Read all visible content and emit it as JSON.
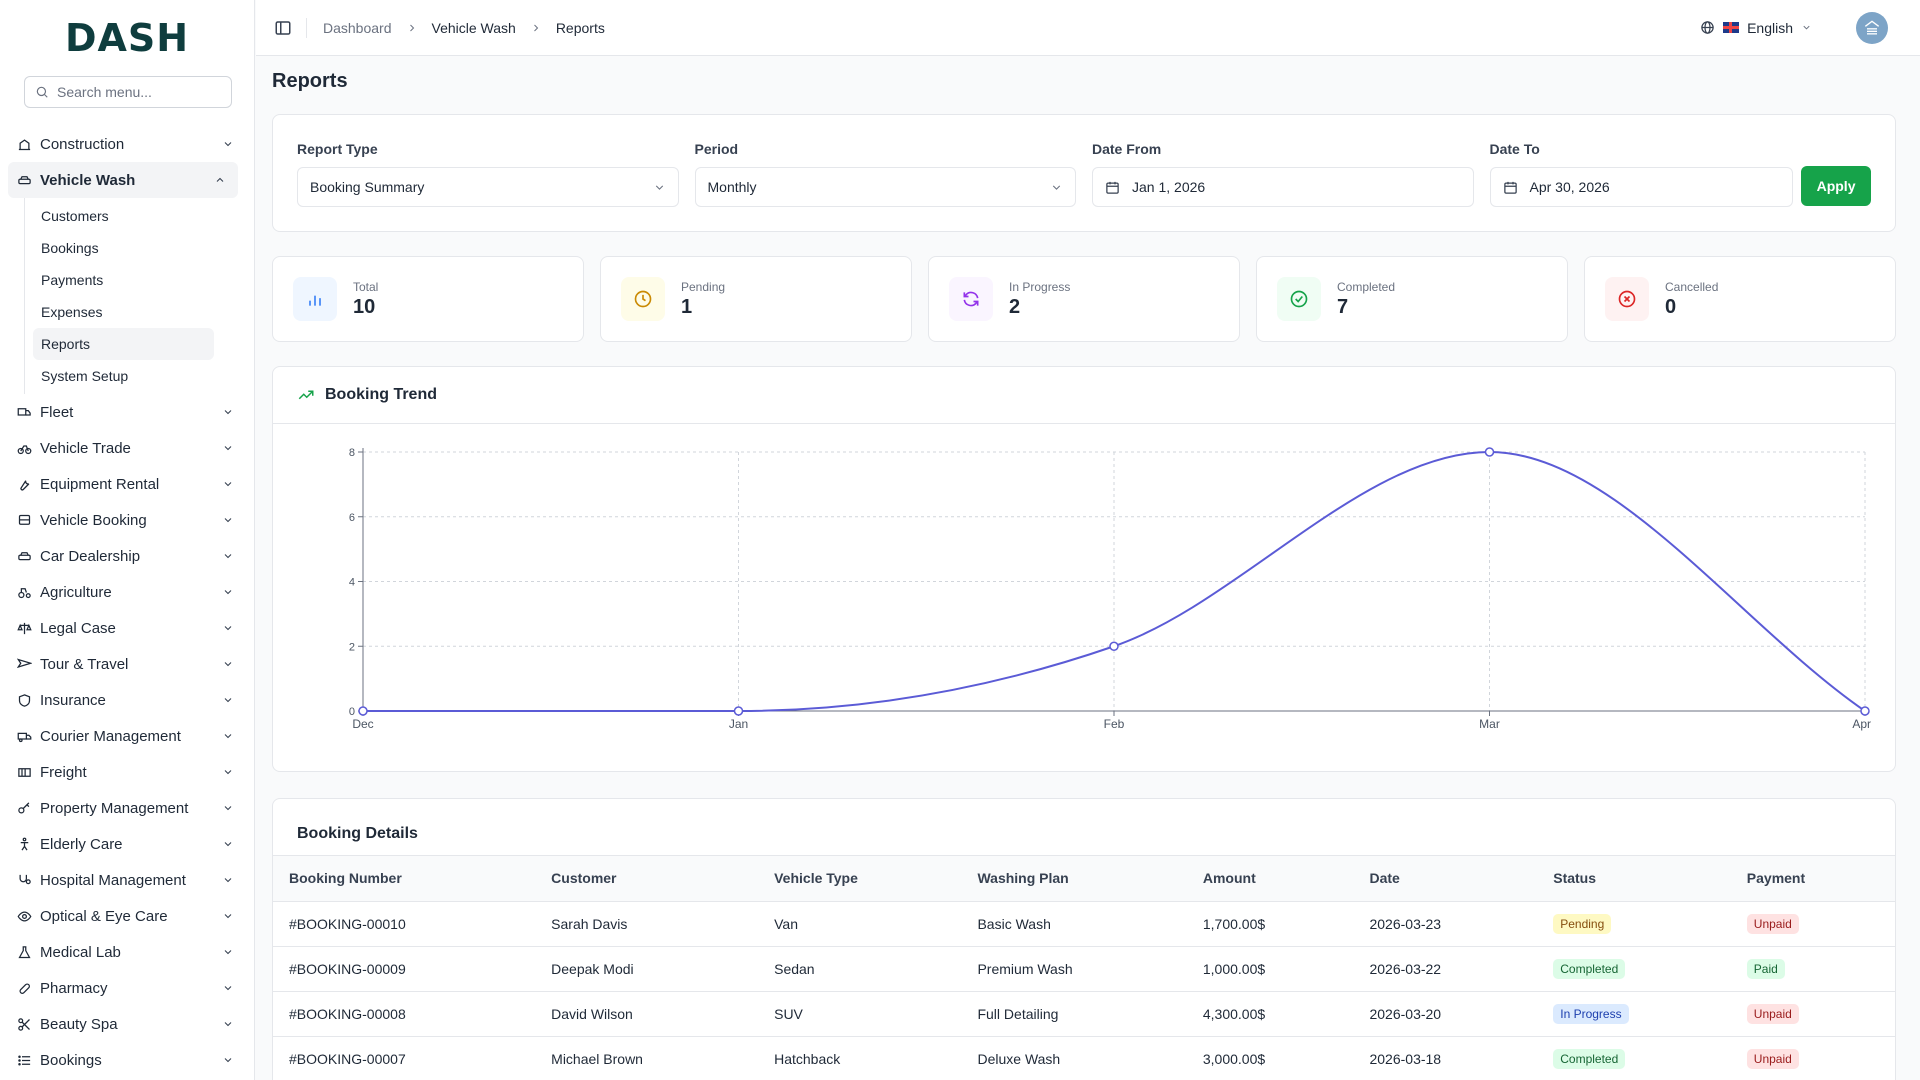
{
  "app": {
    "logo": "DASH"
  },
  "sidebar": {
    "search_placeholder": "Search menu...",
    "items": [
      {
        "label": "Construction",
        "icon": "construction-icon"
      },
      {
        "label": "Vehicle Wash",
        "icon": "car-icon",
        "active": true,
        "children": [
          {
            "label": "Customers"
          },
          {
            "label": "Bookings"
          },
          {
            "label": "Payments"
          },
          {
            "label": "Expenses"
          },
          {
            "label": "Reports",
            "active": true
          },
          {
            "label": "System Setup"
          }
        ]
      },
      {
        "label": "Fleet",
        "icon": "truck-icon"
      },
      {
        "label": "Vehicle Trade",
        "icon": "bike-icon"
      },
      {
        "label": "Equipment Rental",
        "icon": "wrench-icon"
      },
      {
        "label": "Vehicle Booking",
        "icon": "bus-icon"
      },
      {
        "label": "Car Dealership",
        "icon": "car-icon"
      },
      {
        "label": "Agriculture",
        "icon": "tractor-icon"
      },
      {
        "label": "Legal Case",
        "icon": "scale-icon"
      },
      {
        "label": "Tour & Travel",
        "icon": "plane-icon"
      },
      {
        "label": "Insurance",
        "icon": "shield-icon"
      },
      {
        "label": "Courier Management",
        "icon": "delivery-truck-icon"
      },
      {
        "label": "Freight",
        "icon": "container-icon"
      },
      {
        "label": "Property Management",
        "icon": "key-icon"
      },
      {
        "label": "Elderly Care",
        "icon": "accessibility-icon"
      },
      {
        "label": "Hospital Management",
        "icon": "stethoscope-icon"
      },
      {
        "label": "Optical & Eye Care",
        "icon": "eye-icon"
      },
      {
        "label": "Medical Lab",
        "icon": "flask-icon"
      },
      {
        "label": "Pharmacy",
        "icon": "pill-icon"
      },
      {
        "label": "Beauty Spa",
        "icon": "scissors-icon"
      },
      {
        "label": "Bookings",
        "icon": "list-icon"
      }
    ]
  },
  "topbar": {
    "breadcrumb": [
      "Dashboard",
      "Vehicle Wash",
      "Reports"
    ],
    "language": "English"
  },
  "page": {
    "title": "Reports"
  },
  "filters": {
    "report_type": {
      "label": "Report Type",
      "value": "Booking Summary"
    },
    "period": {
      "label": "Period",
      "value": "Monthly"
    },
    "date_from": {
      "label": "Date From",
      "value": "Jan 1, 2026"
    },
    "date_to": {
      "label": "Date To",
      "value": "Apr 30, 2026"
    },
    "apply_label": "Apply"
  },
  "stats": [
    {
      "label": "Total",
      "value": "10",
      "icon": "bar-chart-icon",
      "color": "#3b82f6",
      "bg": "#eff6ff"
    },
    {
      "label": "Pending",
      "value": "1",
      "icon": "clock-icon",
      "color": "#ca8a04",
      "bg": "#fefce8"
    },
    {
      "label": "In Progress",
      "value": "2",
      "icon": "refresh-icon",
      "color": "#9333ea",
      "bg": "#faf5ff"
    },
    {
      "label": "Completed",
      "value": "7",
      "icon": "check-circle-icon",
      "color": "#16a34a",
      "bg": "#f0fdf4"
    },
    {
      "label": "Cancelled",
      "value": "0",
      "icon": "x-circle-icon",
      "color": "#dc2626",
      "bg": "#fef2f2"
    }
  ],
  "trend": {
    "title": "Booking Trend"
  },
  "chart_data": {
    "type": "line",
    "categories": [
      "Dec",
      "Jan",
      "Feb",
      "Mar",
      "Apr"
    ],
    "values": [
      0,
      0,
      2,
      8,
      0
    ],
    "yticks": [
      0,
      2,
      4,
      6,
      8
    ],
    "ylim": [
      0,
      8
    ],
    "grid": true,
    "color": "#5b5bd6"
  },
  "details": {
    "title": "Booking Details",
    "columns": [
      "Booking Number",
      "Customer",
      "Vehicle Type",
      "Washing Plan",
      "Amount",
      "Date",
      "Status",
      "Payment"
    ],
    "rows": [
      [
        "#BOOKING-00010",
        "Sarah Davis",
        "Van",
        "Basic Wash",
        "1,700.00$",
        "2026-03-23",
        "Pending",
        "Unpaid"
      ],
      [
        "#BOOKING-00009",
        "Deepak Modi",
        "Sedan",
        "Premium Wash",
        "1,000.00$",
        "2026-03-22",
        "Completed",
        "Paid"
      ],
      [
        "#BOOKING-00008",
        "David Wilson",
        "SUV",
        "Full Detailing",
        "4,300.00$",
        "2026-03-20",
        "In Progress",
        "Unpaid"
      ],
      [
        "#BOOKING-00007",
        "Michael Brown",
        "Hatchback",
        "Deluxe Wash",
        "3,000.00$",
        "2026-03-18",
        "Completed",
        "Unpaid"
      ]
    ],
    "badge_colors": {
      "Pending": [
        "#fef9c3",
        "#854d0e"
      ],
      "Completed": [
        "#dcfce7",
        "#166534"
      ],
      "In Progress": [
        "#dbeafe",
        "#1e40af"
      ],
      "Paid": [
        "#dcfce7",
        "#166534"
      ],
      "Unpaid": [
        "#fee2e2",
        "#991b1b"
      ]
    }
  }
}
